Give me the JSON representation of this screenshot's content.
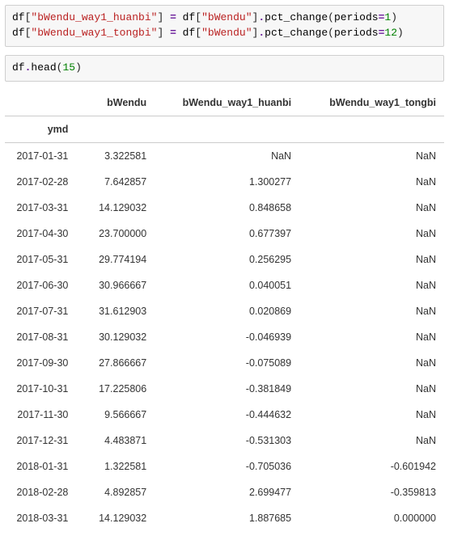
{
  "chart_data": {
    "type": "table",
    "index_name": "ymd",
    "columns": [
      "bWendu",
      "bWendu_way1_huanbi",
      "bWendu_way1_tongbi"
    ],
    "index": [
      "2017-01-31",
      "2017-02-28",
      "2017-03-31",
      "2017-04-30",
      "2017-05-31",
      "2017-06-30",
      "2017-07-31",
      "2017-08-31",
      "2017-09-30",
      "2017-10-31",
      "2017-11-30",
      "2017-12-31",
      "2018-01-31",
      "2018-02-28",
      "2018-03-31"
    ],
    "data": [
      [
        3.322581,
        null,
        null
      ],
      [
        7.642857,
        1.300277,
        null
      ],
      [
        14.129032,
        0.848658,
        null
      ],
      [
        23.7,
        0.677397,
        null
      ],
      [
        29.774194,
        0.256295,
        null
      ],
      [
        30.966667,
        0.040051,
        null
      ],
      [
        31.612903,
        0.020869,
        null
      ],
      [
        30.129032,
        -0.046939,
        null
      ],
      [
        27.866667,
        -0.075089,
        null
      ],
      [
        17.225806,
        -0.381849,
        null
      ],
      [
        9.566667,
        -0.444632,
        null
      ],
      [
        4.483871,
        -0.531303,
        null
      ],
      [
        1.322581,
        -0.705036,
        -0.601942
      ],
      [
        4.892857,
        2.699477,
        -0.359813
      ],
      [
        14.129032,
        1.887685,
        0.0
      ]
    ]
  },
  "code_cell_1": {
    "line1": {
      "a": "df",
      "b": "[",
      "c": "\"bWendu_way1_huanbi\"",
      "d": "]",
      "e": " = ",
      "f": "df",
      "g": "[",
      "h": "\"bWendu\"",
      "i": "]",
      "j": ".",
      "k": "pct_change",
      "l": "(",
      "m": "periods",
      "n": "=",
      "o": "1",
      "p": ")"
    },
    "line2": {
      "a": "df",
      "b": "[",
      "c": "\"bWendu_way1_tongbi\"",
      "d": "]",
      "e": " = ",
      "f": "df",
      "g": "[",
      "h": "\"bWendu\"",
      "i": "]",
      "j": ".",
      "k": "pct_change",
      "l": "(",
      "m": "periods",
      "n": "=",
      "o": "12",
      "p": ")"
    }
  },
  "code_cell_2": {
    "a": "df",
    "b": ".",
    "c": "head",
    "d": "(",
    "e": "15",
    "f": ")"
  },
  "table": {
    "index_label": "ymd",
    "columns": [
      "bWendu",
      "bWendu_way1_huanbi",
      "bWendu_way1_tongbi"
    ],
    "rows": [
      {
        "idx": "2017-01-31",
        "c0": "3.322581",
        "c1": "NaN",
        "c2": "NaN"
      },
      {
        "idx": "2017-02-28",
        "c0": "7.642857",
        "c1": "1.300277",
        "c2": "NaN"
      },
      {
        "idx": "2017-03-31",
        "c0": "14.129032",
        "c1": "0.848658",
        "c2": "NaN"
      },
      {
        "idx": "2017-04-30",
        "c0": "23.700000",
        "c1": "0.677397",
        "c2": "NaN"
      },
      {
        "idx": "2017-05-31",
        "c0": "29.774194",
        "c1": "0.256295",
        "c2": "NaN"
      },
      {
        "idx": "2017-06-30",
        "c0": "30.966667",
        "c1": "0.040051",
        "c2": "NaN"
      },
      {
        "idx": "2017-07-31",
        "c0": "31.612903",
        "c1": "0.020869",
        "c2": "NaN"
      },
      {
        "idx": "2017-08-31",
        "c0": "30.129032",
        "c1": "-0.046939",
        "c2": "NaN"
      },
      {
        "idx": "2017-09-30",
        "c0": "27.866667",
        "c1": "-0.075089",
        "c2": "NaN"
      },
      {
        "idx": "2017-10-31",
        "c0": "17.225806",
        "c1": "-0.381849",
        "c2": "NaN"
      },
      {
        "idx": "2017-11-30",
        "c0": "9.566667",
        "c1": "-0.444632",
        "c2": "NaN"
      },
      {
        "idx": "2017-12-31",
        "c0": "4.483871",
        "c1": "-0.531303",
        "c2": "NaN"
      },
      {
        "idx": "2018-01-31",
        "c0": "1.322581",
        "c1": "-0.705036",
        "c2": "-0.601942"
      },
      {
        "idx": "2018-02-28",
        "c0": "4.892857",
        "c1": "2.699477",
        "c2": "-0.359813"
      },
      {
        "idx": "2018-03-31",
        "c0": "14.129032",
        "c1": "1.887685",
        "c2": "0.000000"
      }
    ]
  }
}
